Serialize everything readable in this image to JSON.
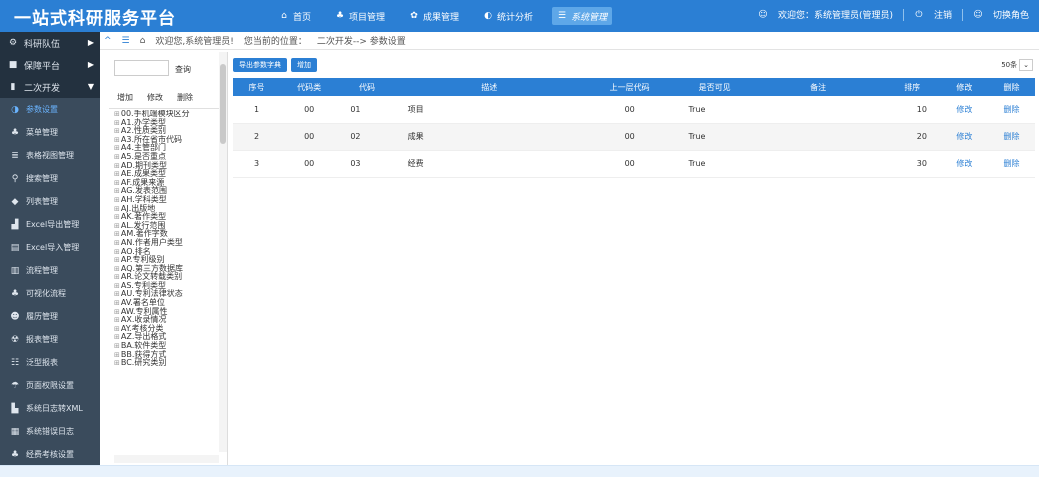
{
  "app": {
    "title": "一站式科研服务平台"
  },
  "topnav": {
    "items": [
      {
        "icon": "home-icon",
        "label": "首页"
      },
      {
        "icon": "project-icon",
        "label": "项目管理"
      },
      {
        "icon": "award-icon",
        "label": "成果管理"
      },
      {
        "icon": "chart-icon",
        "label": "统计分析"
      },
      {
        "icon": "system-icon",
        "label": "系统管理"
      }
    ]
  },
  "userbar": {
    "welcome": "欢迎您：系统管理员(管理员)",
    "logout": "注销",
    "switch_role": "切换角色"
  },
  "sidebar": {
    "items": [
      {
        "icon": "gear-icon",
        "label": "科研队伍"
      },
      {
        "icon": "folder-icon",
        "label": "保障平台"
      },
      {
        "icon": "dev-icon",
        "label": "二次开发"
      },
      {
        "icon": "circle-icon",
        "label": "参数设置"
      },
      {
        "icon": "users-icon",
        "label": "菜单管理"
      },
      {
        "icon": "db-icon",
        "label": "表格视图管理"
      },
      {
        "icon": "search-icon",
        "label": "搜索管理"
      },
      {
        "icon": "tag-icon",
        "label": "列表管理"
      },
      {
        "icon": "excel-icon",
        "label": "Excel导出管理"
      },
      {
        "icon": "import-icon",
        "label": "Excel导入管理"
      },
      {
        "icon": "flow-icon",
        "label": "流程管理"
      },
      {
        "icon": "visual-icon",
        "label": "可视化流程"
      },
      {
        "icon": "user-icon",
        "label": "履历管理"
      },
      {
        "icon": "report-icon",
        "label": "报表管理"
      },
      {
        "icon": "list-icon",
        "label": "泛型报表"
      },
      {
        "icon": "perm-icon",
        "label": "页面权限设置"
      },
      {
        "icon": "xml-icon",
        "label": "系统日志转XML"
      },
      {
        "icon": "log-icon",
        "label": "系统错误日志"
      },
      {
        "icon": "stat-icon",
        "label": "经费考核设置"
      }
    ]
  },
  "breadcrumb": {
    "welcome": "欢迎您,系统管理员!",
    "location_label": "您当前的位置：",
    "path": "二次开发--> 参数设置"
  },
  "tree": {
    "search_button": "查询",
    "tools": [
      "增加",
      "修改",
      "删除"
    ],
    "nodes": [
      "00.手机端模块区分",
      "A1.办学类型",
      "A2.性质类别",
      "A3.所在省市代码",
      "A4.主管部门",
      "A5.是否重点",
      "AD.期刊类型",
      "AE.成果类型",
      "AF.成果来源",
      "AG.发表范围",
      "AH.学科类型",
      "AJ.出版地",
      "AK.著作类型",
      "AL.发行范围",
      "AM.著作字数",
      "AN.作者用户类型",
      "AO.排名",
      "AP.专利级别",
      "AQ.第三方数据库",
      "AR.论文转载类别",
      "AS.专利类型",
      "AU.专利法律状态",
      "AV.署名单位",
      "AW.专利属性",
      "AX.收录情况",
      "AY.考核分类",
      "AZ.导出格式",
      "BA.软件类型",
      "BB.获得方式",
      "BC.研究类别"
    ]
  },
  "toolbar": {
    "export_label": "导出参数字典",
    "add_label": "增加",
    "page_size": "50条"
  },
  "table": {
    "headers": [
      "序号",
      "代码类",
      "代码",
      "描述",
      "上一层代码",
      "是否可见",
      "备注",
      "排序",
      "修改",
      "删除"
    ],
    "rows": [
      [
        "1",
        "00",
        "01",
        "项目",
        "00",
        "True",
        "",
        "10",
        "修改",
        "删除"
      ],
      [
        "2",
        "00",
        "02",
        "成果",
        "00",
        "True",
        "",
        "20",
        "修改",
        "删除"
      ],
      [
        "3",
        "00",
        "03",
        "经费",
        "00",
        "True",
        "",
        "30",
        "修改",
        "删除"
      ]
    ]
  }
}
